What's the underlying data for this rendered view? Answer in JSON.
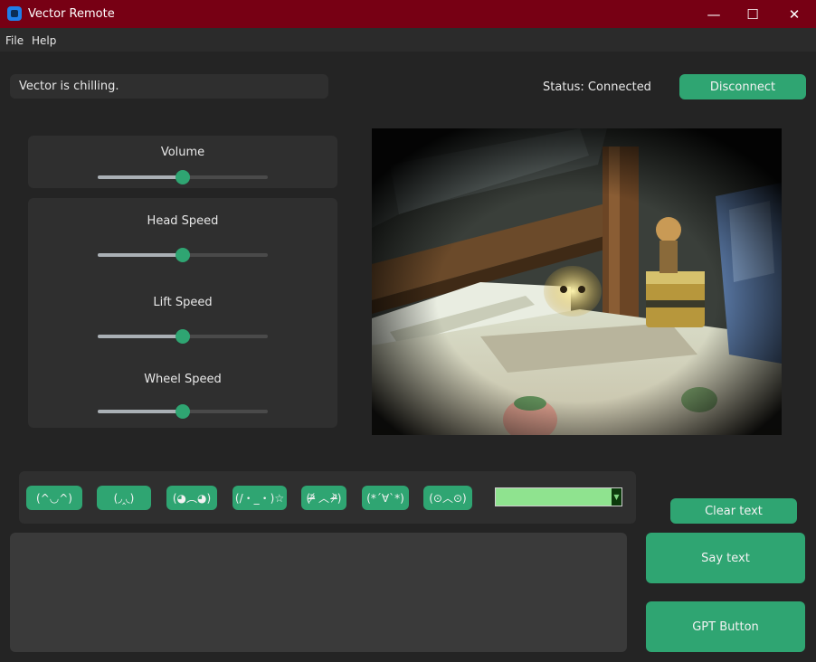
{
  "window": {
    "title": "Vector Remote",
    "minimize": "—",
    "maximize": "☐",
    "close": "✕"
  },
  "menu": {
    "file": "File",
    "help": "Help"
  },
  "status": {
    "message": "Vector is chilling.",
    "connection": "Status: Connected",
    "disconnect_label": "Disconnect"
  },
  "sliders": {
    "volume": {
      "label": "Volume",
      "value": 0.5
    },
    "head_speed": {
      "label": "Head Speed",
      "value": 0.5
    },
    "lift_speed": {
      "label": "Lift Speed",
      "value": 0.5
    },
    "wheel_speed": {
      "label": "Wheel Speed",
      "value": 0.5
    }
  },
  "emotes": [
    "(^◡^)",
    "(◞‸◟)",
    "(◕︵◕)",
    "(/・_・)☆",
    "(ᵒ̴̶̷᷄ ︿ ᵒ̴̶̷᷅)",
    "(*´∀`*)",
    "(⊙︿⊙)"
  ],
  "color_picker": {
    "value": "#8fe38f"
  },
  "buttons": {
    "clear_text": "Clear text",
    "say_text": "Say text",
    "gpt": "GPT Button"
  },
  "text_input": {
    "value": ""
  },
  "colors": {
    "accent": "#2fa572",
    "titlebar": "#770014",
    "background": "#242424",
    "panel": "#2f2f2f"
  }
}
